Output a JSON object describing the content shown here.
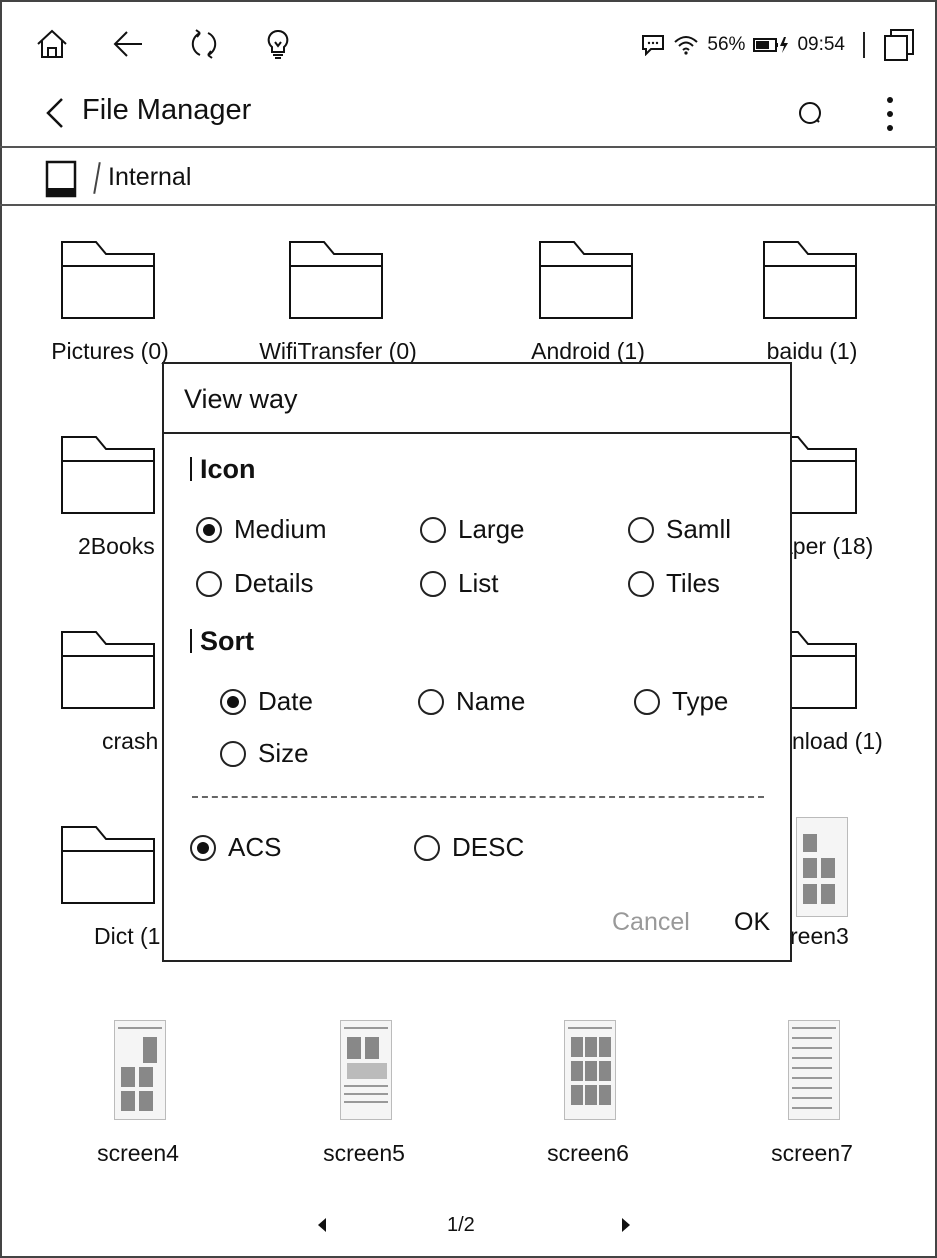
{
  "status": {
    "battery": "56%",
    "time": "09:54"
  },
  "header": {
    "title": "File Manager"
  },
  "path": {
    "location": "Internal"
  },
  "files": {
    "row1": [
      "Pictures (0)",
      "WifiTransfer (0)",
      "Android (1)",
      "baidu (1)"
    ],
    "row2": [
      "2Books",
      "aper (18)"
    ],
    "row3": [
      "crash",
      "nload (1)"
    ],
    "row4": [
      "Dict (1",
      "reen3"
    ],
    "row5": [
      "screen4",
      "screen5",
      "screen6",
      "screen7"
    ]
  },
  "pager": {
    "page": "1/2"
  },
  "dialog": {
    "title": "View way",
    "icon_section": "Icon",
    "icon_options": [
      "Medium",
      "Large",
      "Samll",
      "Details",
      "List",
      "Tiles"
    ],
    "icon_selected": "Medium",
    "sort_section": "Sort",
    "sort_options": [
      "Date",
      "Name",
      "Type",
      "Size"
    ],
    "sort_selected": "Date",
    "order_options": [
      "ACS",
      "DESC"
    ],
    "order_selected": "ACS",
    "cancel": "Cancel",
    "ok": "OK"
  }
}
